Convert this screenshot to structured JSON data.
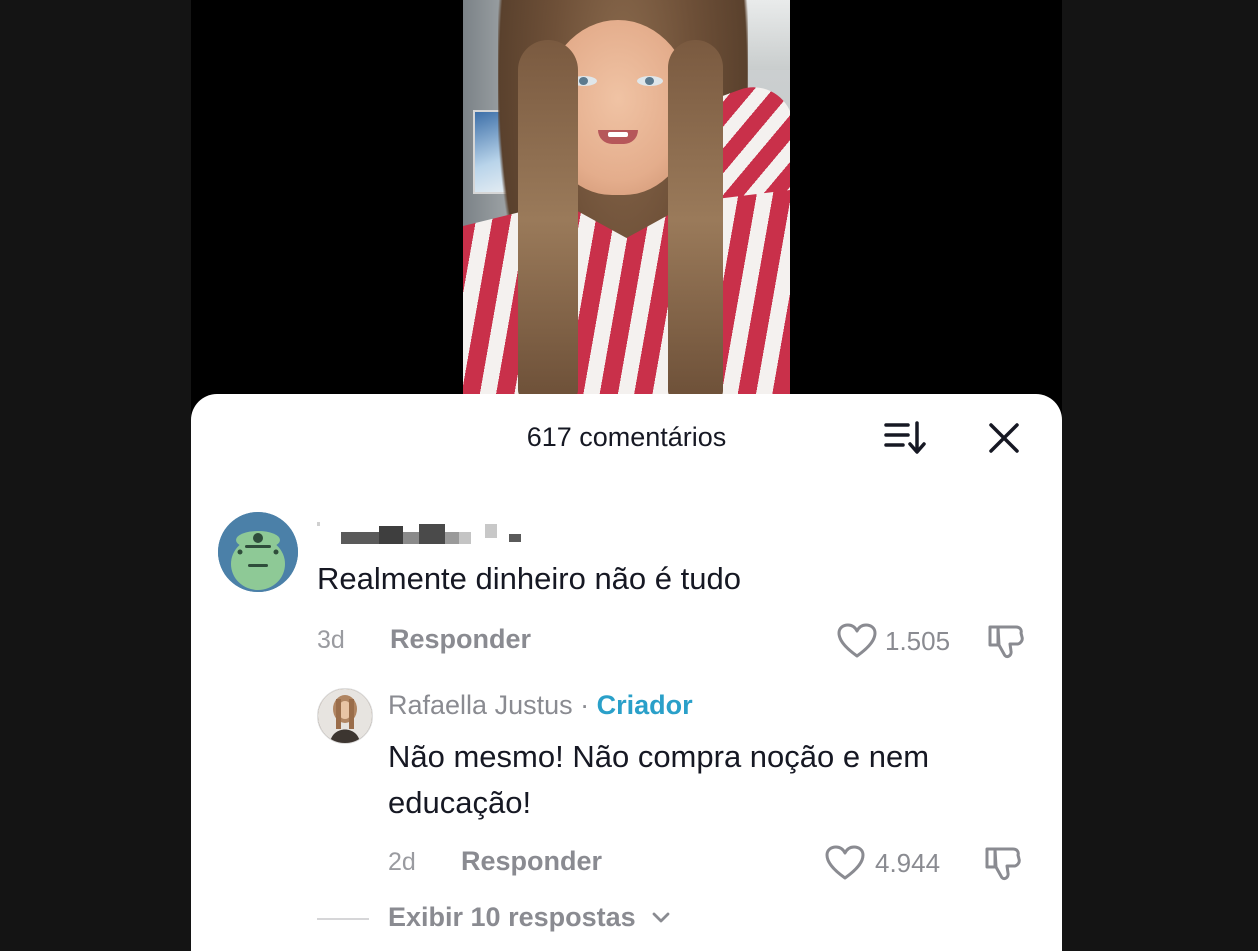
{
  "comments_panel": {
    "title": "617 comentários",
    "sort_icon": "sort-icon",
    "close_icon": "close-icon"
  },
  "comment": {
    "avatar_icon": "frog-avatar",
    "username": "",
    "text": "Realmente dinheiro não é tudo",
    "time": "3d",
    "reply_label": "Responder",
    "likes": "1.505",
    "like_icon": "heart-icon",
    "dislike_icon": "thumbs-down-icon"
  },
  "reply": {
    "author": "Rafaella Justus",
    "separator": " · ",
    "badge": "Criador",
    "text": "Não mesmo! Não compra noção e nem educação!",
    "time": "2d",
    "reply_label": "Responder",
    "likes": "4.944",
    "like_icon": "heart-icon",
    "dislike_icon": "thumbs-down-icon"
  },
  "view_replies": {
    "label": "Exibir 10 respostas",
    "icon": "chevron-down-icon"
  },
  "colors": {
    "background": "#141414",
    "sheet": "#ffffff",
    "text_primary": "#161823",
    "text_secondary": "#8a8b91",
    "creator_accent": "#2aa0c9"
  }
}
